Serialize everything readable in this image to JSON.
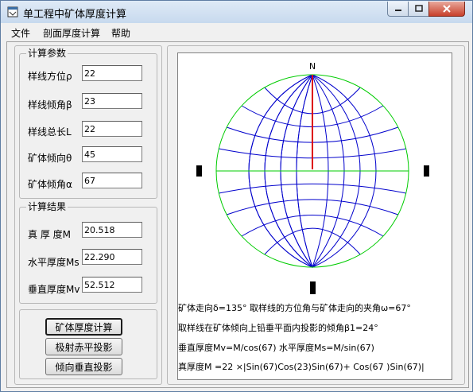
{
  "window": {
    "title": "单工程中矿体厚度计算"
  },
  "menu": [
    "文件",
    "剖面厚度计算",
    "帮助"
  ],
  "params": {
    "title": "计算参数",
    "fields": [
      {
        "label": "样线方位ρ",
        "value": "22"
      },
      {
        "label": "样线倾角β",
        "value": "23"
      },
      {
        "label": "样线总长L",
        "value": "22"
      },
      {
        "label": "矿体倾向θ",
        "value": "45"
      },
      {
        "label": "矿体倾角α",
        "value": "67"
      }
    ]
  },
  "results": {
    "title": "计算结果",
    "fields": [
      {
        "label": "真 厚 度M",
        "value": "20.518"
      },
      {
        "label": "水平厚度Ms",
        "value": "22.290"
      },
      {
        "label": "垂直厚度Mv",
        "value": "52.512"
      }
    ]
  },
  "buttons": [
    "矿体厚度计算",
    "极射赤平投影",
    "倾向垂直投影"
  ],
  "stereonet": {
    "north_label": "N",
    "colors": {
      "primitive": "#00cc00",
      "grid": "#0000cc",
      "axis": "#00cc00",
      "line": "#dd0000",
      "ticks": "#000000"
    }
  },
  "info_lines": [
    "矿体走向δ=135°      取样线的方位角与矿体走向的夹角ω=67°",
    "取样线在矿体倾向上铅垂平面内投影的倾角β1=24°",
    "垂直厚度Mv=M/cos(67)       水平厚度Ms=M/sin(67)",
    "真厚度M =22 ×|Sin(67)Cos(23)Sin(67)+ Cos(67 )Sin(67)|"
  ]
}
